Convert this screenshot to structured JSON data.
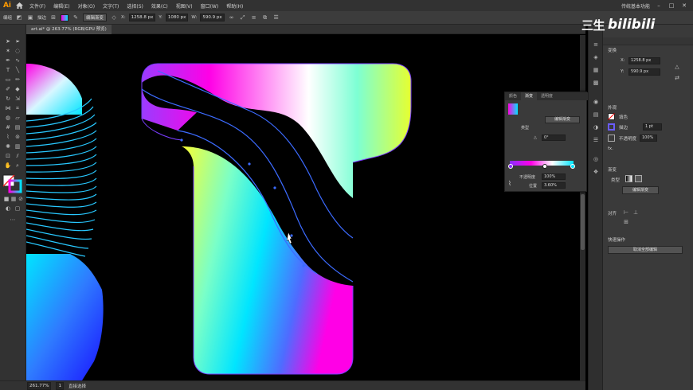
{
  "app": {
    "logo": "Ai",
    "menus": [
      "文件(F)",
      "编辑(E)",
      "对象(O)",
      "文字(T)",
      "选择(S)",
      "效果(C)",
      "视图(V)",
      "窗口(W)",
      "帮助(H)"
    ],
    "workspace": "传统基本功能"
  },
  "control_bar": {
    "object_type": "编组",
    "stroke_label": "描边",
    "gradient_edit_button": "编辑渐变",
    "x_value": "1258.8 px",
    "y_value": "1080 px",
    "w_value": "590.9 px"
  },
  "document": {
    "tab_title": "art.ai* @ 263.77% (RGB/GPU 预览)"
  },
  "status": {
    "zoom": "261.77%",
    "page": "1",
    "mode": "直接选择"
  },
  "properties": {
    "section_transform": "变换",
    "x_value": "1258.8 px",
    "y_value": "590.9 px",
    "section_appearance": "外观",
    "fill_label": "填色",
    "stroke_label": "描边",
    "stroke_weight": "1 pt",
    "opacity_label": "不透明度",
    "opacity_value": "100%",
    "fx_label": "fx.",
    "section_gradient": "渐变",
    "gradient_type_label": "类型",
    "gradient_edit_button": "编辑渐变",
    "section_align": "对齐",
    "section_quick": "快速操作",
    "quick_action_button": "取消全部编辑"
  },
  "gradient_panel": {
    "tabs": [
      "颜色",
      "渐变",
      "透明度"
    ],
    "edit_button": "编辑渐变",
    "type_label": "类型",
    "angle_label": "△",
    "angle_value": "0°",
    "opacity_label": "不透明度",
    "opacity_value": "100%",
    "location_label": "位置",
    "location_value": "3.60%"
  },
  "watermark": {
    "text_a": "三生",
    "text_b": "bilibili"
  },
  "colors": {
    "magenta": "#ff00e6",
    "cyan": "#00e5ff",
    "blue": "#1a3cff",
    "yellow": "#faff30",
    "outline": "#7a3cff"
  }
}
